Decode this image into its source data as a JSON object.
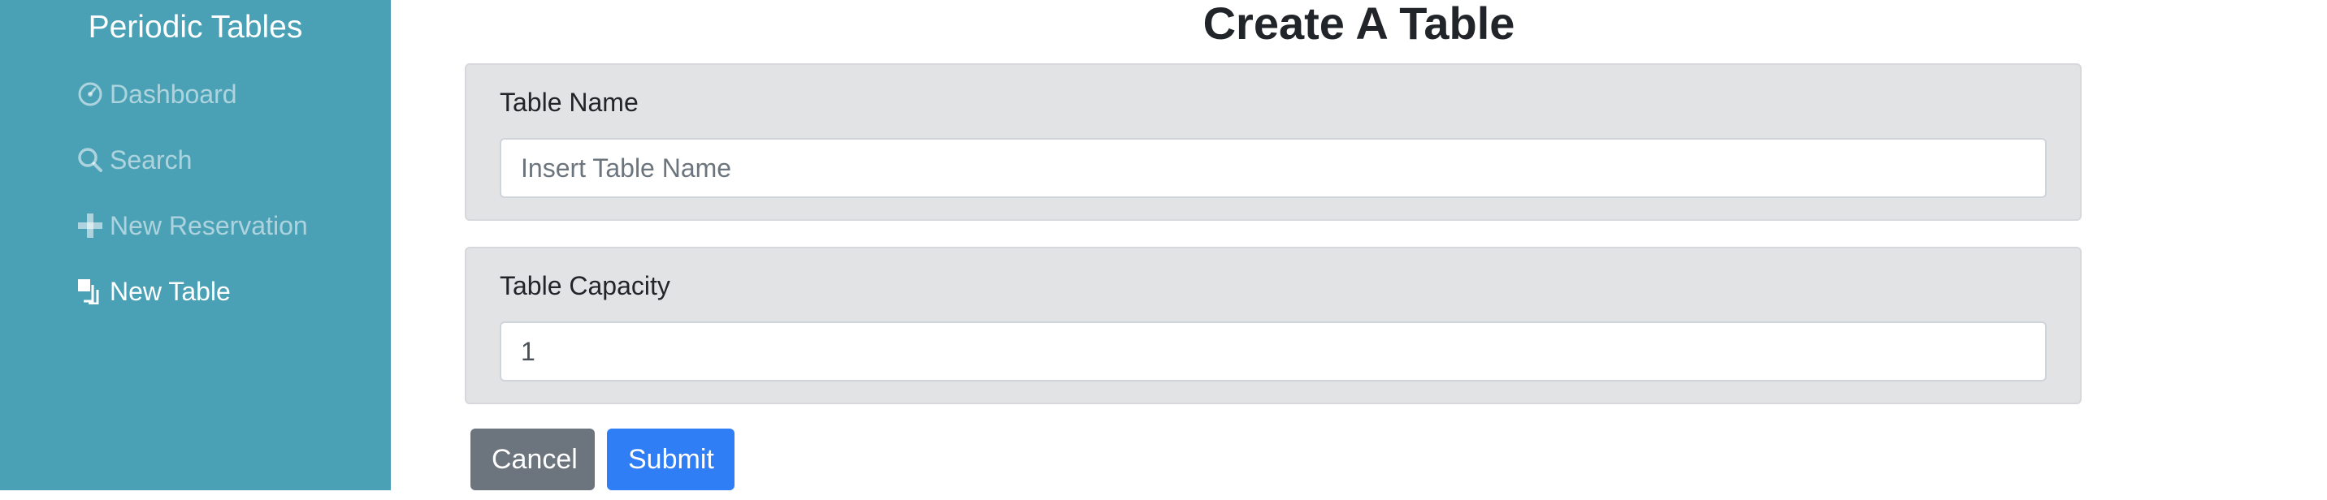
{
  "sidebar": {
    "brand": "Periodic Tables",
    "items": [
      {
        "label": "Dashboard",
        "icon": "dashboard-icon"
      },
      {
        "label": "Search",
        "icon": "search-icon"
      },
      {
        "label": "New Reservation",
        "icon": "plus-icon"
      },
      {
        "label": "New Table",
        "icon": "layers-icon"
      }
    ]
  },
  "main": {
    "title": "Create A Table",
    "fields": {
      "table_name": {
        "label": "Table Name",
        "placeholder": "Insert Table Name",
        "value": ""
      },
      "table_capacity": {
        "label": "Table Capacity",
        "value": "1"
      }
    },
    "buttons": {
      "cancel": "Cancel",
      "submit": "Submit"
    }
  },
  "colors": {
    "sidebar_bg": "#4aa1b5",
    "form_group_bg": "#e2e3e5",
    "cancel_bg": "#6c757d",
    "submit_bg": "#2f7ef5"
  }
}
